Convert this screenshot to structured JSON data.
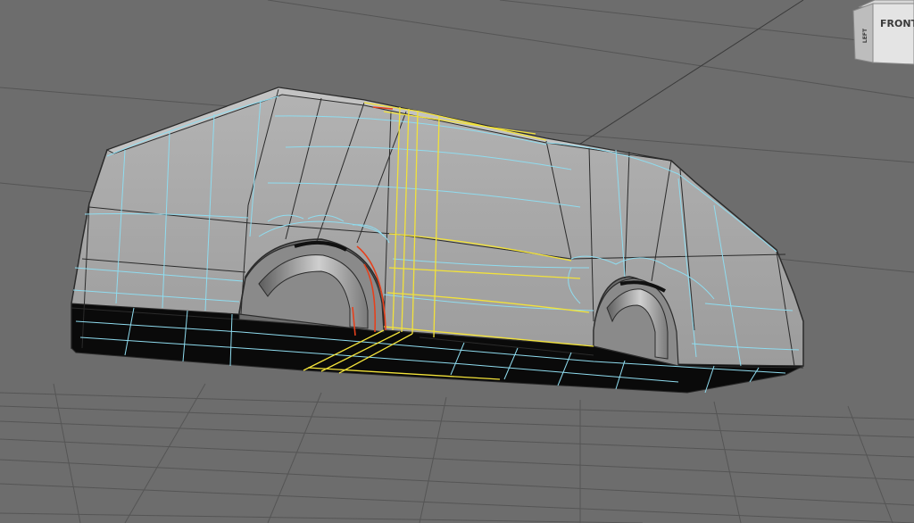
{
  "viewport": {
    "background": "#6d6d6d",
    "colors": {
      "grid": "#5a5a5a",
      "body_fill": "#a6a6a6",
      "underside": "#0a0a0a",
      "edges_dark": "#2b2b2b",
      "edges_cyan": "#8fdcef",
      "selection_yellow": "#f2e23a",
      "selection_red": "#e6401c"
    }
  },
  "view_cube": {
    "front_label": "FRONT",
    "left_label": "LEFT"
  }
}
